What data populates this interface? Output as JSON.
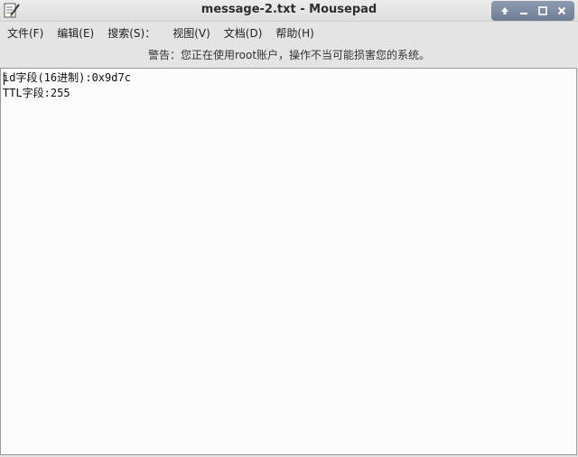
{
  "window": {
    "title": "message-2.txt - Mousepad",
    "icon": "text-editor-icon"
  },
  "wm_buttons": {
    "icons": [
      "up-arrow-icon",
      "minimize-icon",
      "maximize-icon",
      "close-icon"
    ]
  },
  "menubar": {
    "items": [
      {
        "label": "文件(F)"
      },
      {
        "label": "编辑(E)"
      },
      {
        "label": "搜索(S)："
      },
      {
        "label": "视图(V)"
      },
      {
        "label": "文档(D)"
      },
      {
        "label": "帮助(H)"
      }
    ]
  },
  "warning": {
    "text": "警告：您正在使用root账户，操作不当可能损害您的系统。"
  },
  "editor": {
    "lines": [
      "id字段(16进制):0x9d7c",
      "TTL字段:255"
    ]
  },
  "colors": {
    "wm_button_bg": "#7d8aa1",
    "editor_bg": "#fcfcfc"
  }
}
